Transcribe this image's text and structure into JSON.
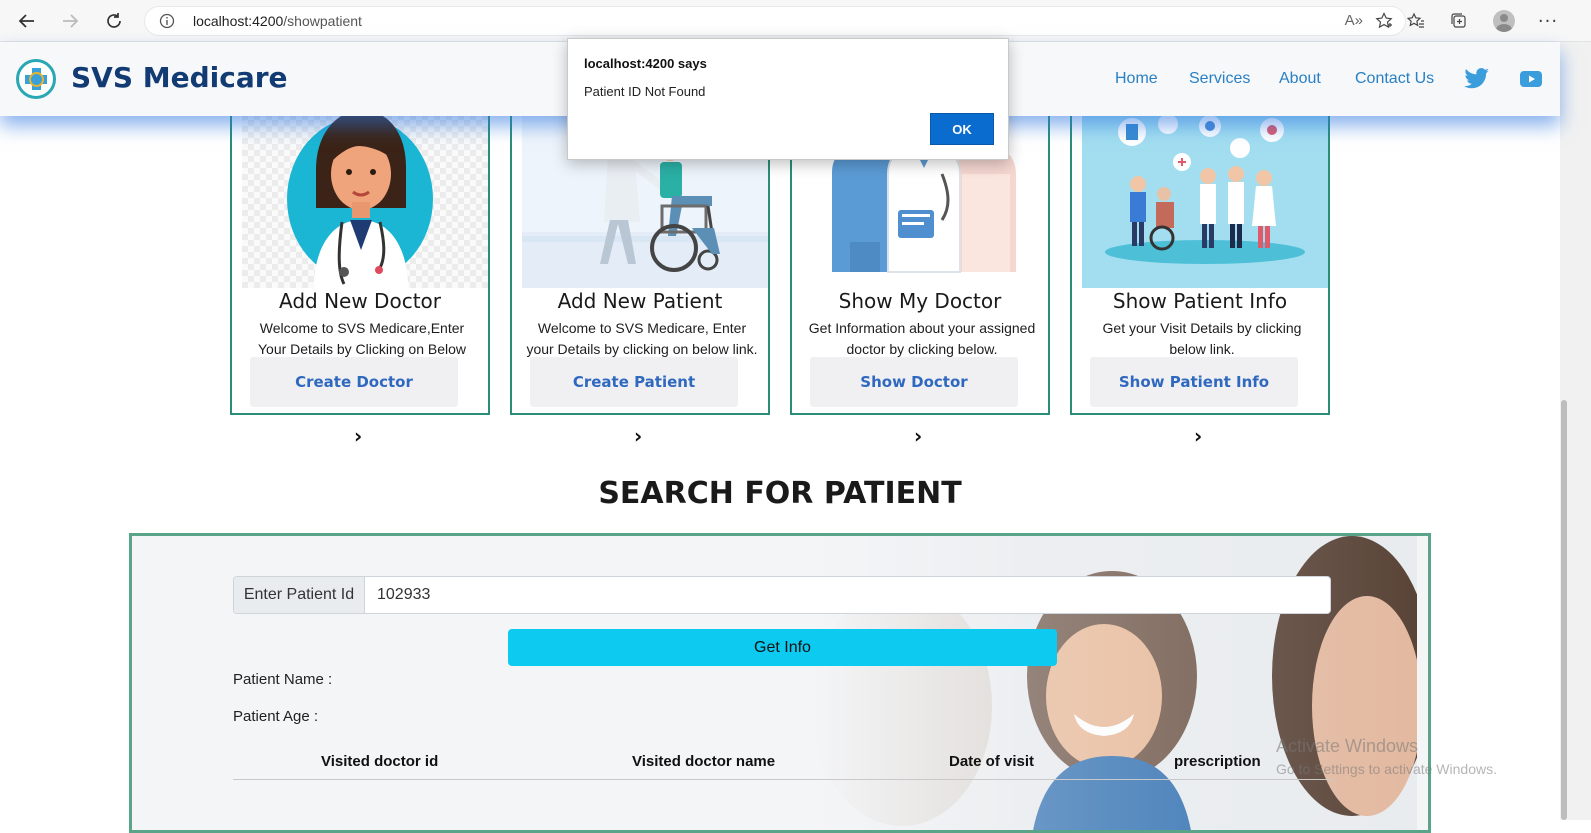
{
  "browser": {
    "url_host": "localhost:4200",
    "url_path": "/showpatient",
    "read_aloud_icon": "A»"
  },
  "site": {
    "brand": "SVS Medicare",
    "nav": [
      "Home",
      "Services",
      "About",
      "Contact Us"
    ]
  },
  "dialog": {
    "title": "localhost:4200 says",
    "message": "Patient ID Not Found",
    "ok_label": "OK"
  },
  "cards": [
    {
      "title": "Add New Doctor",
      "text": "Welcome to SVS Medicare,Enter Your Details by Clicking on Below Button.",
      "button": "Create Doctor"
    },
    {
      "title": "Add New Patient",
      "text": "Welcome to SVS Medicare, Enter your Details by clicking on below link.",
      "button": "Create Patient"
    },
    {
      "title": "Show My Doctor",
      "text": "Get Information about your assigned doctor by clicking below.",
      "button": "Show Doctor"
    },
    {
      "title": "Show Patient Info",
      "text": "Get your Visit Details by clicking below link.",
      "button": "Show Patient Info"
    }
  ],
  "chevron": "›",
  "search": {
    "title": "SEARCH FOR PATIENT",
    "id_label": "Enter Patient Id",
    "id_value": "102933",
    "button": "Get Info",
    "name_label": "Patient Name :",
    "age_label": "Patient Age :",
    "columns": [
      "Visited doctor id",
      "Visited doctor name",
      "Date of visit",
      "prescription"
    ]
  },
  "watermark": {
    "line1": "Activate Windows",
    "line2": "Go to Settings to activate Windows."
  },
  "colors": {
    "brand": "#133b73",
    "nav": "#2a80c4",
    "card_border": "#2a8d78",
    "info_button": "#0dcaf0",
    "dialog_ok": "#0a6ccf"
  }
}
